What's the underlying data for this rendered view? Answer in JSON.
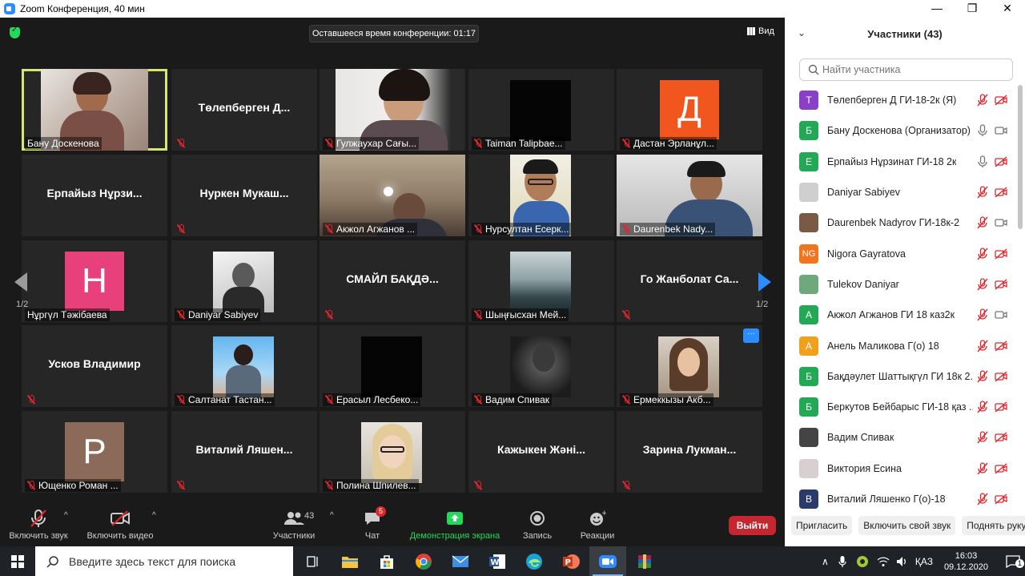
{
  "window": {
    "title": "Zoom Конференция, 40 мин",
    "minimize": "—",
    "restore": "❐",
    "close": "✕"
  },
  "meeting": {
    "timer": "Оставшееся время конференции: 01:17",
    "view_label": "Вид",
    "page_left": "1/2",
    "page_right": "1/2",
    "more": "···",
    "tiles": [
      {
        "label": "Бану Доскенова",
        "name": "",
        "muted": false,
        "kind": "video-1",
        "active": true
      },
      {
        "label": "",
        "name": "Төлепберген Д...",
        "muted": true,
        "kind": "name"
      },
      {
        "label": "Гулжаухар Сағы...",
        "name": "",
        "muted": true,
        "kind": "video-2"
      },
      {
        "label": "Taiman Talipbae...",
        "name": "",
        "muted": true,
        "kind": "black"
      },
      {
        "label": "Дастан Эрланұл...",
        "name": "",
        "muted": true,
        "kind": "avatar",
        "letter": "Д",
        "color": "#f0561d"
      },
      {
        "label": "",
        "name": "Ерпайыз Нұрзи...",
        "muted": false,
        "kind": "name"
      },
      {
        "label": "",
        "name": "Нуркен Мукаш...",
        "muted": true,
        "kind": "name"
      },
      {
        "label": "Акжол Агжанов ...",
        "name": "",
        "muted": true,
        "kind": "video-3"
      },
      {
        "label": "Нурсултан Есерк...",
        "name": "",
        "muted": true,
        "kind": "video-4"
      },
      {
        "label": "Daurenbek Nady...",
        "name": "",
        "muted": true,
        "kind": "video-5"
      },
      {
        "label": "Нұргүл Тәжібаева",
        "name": "",
        "muted": false,
        "kind": "avatar",
        "letter": "Н",
        "color": "#e8407a"
      },
      {
        "label": "Daniyar Sabiyev",
        "name": "",
        "muted": true,
        "kind": "photo-bw"
      },
      {
        "label": "",
        "name": "СМАЙЛ БАҚДӘ...",
        "muted": true,
        "kind": "name"
      },
      {
        "label": "Шыңғысхан Мей...",
        "name": "",
        "muted": true,
        "kind": "photo-forest"
      },
      {
        "label": "",
        "name": "Го Жанболат Са...",
        "muted": true,
        "kind": "name"
      },
      {
        "label": "",
        "name": "Усков Владимир",
        "muted": true,
        "kind": "name"
      },
      {
        "label": "Салтанат Тастан...",
        "name": "",
        "muted": true,
        "kind": "photo-sky"
      },
      {
        "label": "Ерасыл Лесбеко...",
        "name": "",
        "muted": true,
        "kind": "black"
      },
      {
        "label": "Вадим Спивак",
        "name": "",
        "muted": true,
        "kind": "photo-dark"
      },
      {
        "label": "Ермеккызы Акб...",
        "name": "",
        "muted": true,
        "kind": "photo-girl"
      },
      {
        "label": "Ющенко Роман ...",
        "name": "",
        "muted": true,
        "kind": "avatar",
        "letter": "P",
        "color": "#8b6a5a"
      },
      {
        "label": "",
        "name": "Виталий Ляшен...",
        "muted": true,
        "kind": "name"
      },
      {
        "label": "Полина Шпилев...",
        "name": "",
        "muted": true,
        "kind": "photo-blonde"
      },
      {
        "label": "",
        "name": "Кажыкен Жәні...",
        "muted": true,
        "kind": "name"
      },
      {
        "label": "",
        "name": "Зарина Лукман...",
        "muted": true,
        "kind": "name"
      }
    ]
  },
  "toolbar": {
    "audio_label": "Включить звук",
    "video_label": "Включить видео",
    "participants_label": "Участники",
    "participants_count": "43",
    "chat_label": "Чат",
    "chat_badge": "5",
    "share_label": "Демонстрация экрана",
    "record_label": "Запись",
    "reactions_label": "Реакции",
    "leave_label": "Выйти",
    "share_color": "#23d959",
    "leave_color": "#c4272f"
  },
  "panel": {
    "title": "Участники (43)",
    "search_placeholder": "Найти участника",
    "participants": [
      {
        "name": "Төлепберген Д ГИ-18-2к (Я)",
        "initial": "Т",
        "color": "#8a3fc7",
        "mic": "muted",
        "cam": "off"
      },
      {
        "name": "Бану Доскенова (Организатор)",
        "initial": "Б",
        "color": "#23a956",
        "mic": "on",
        "cam": "on"
      },
      {
        "name": "Ерпайыз Нұрзинат ГИ-18 2к",
        "initial": "Е",
        "color": "#23a956",
        "mic": "on",
        "cam": "off"
      },
      {
        "name": "Daniyar Sabiyev",
        "initial": "",
        "color": "#cfcfcf",
        "mic": "muted",
        "cam": "off"
      },
      {
        "name": "Daurenbek Nadyrov ГИ-18к-2",
        "initial": "",
        "color": "#7a5a45",
        "mic": "muted",
        "cam": "on"
      },
      {
        "name": "Nigora Gayratova",
        "initial": "NG",
        "color": "#f0751d",
        "mic": "muted",
        "cam": "off"
      },
      {
        "name": "Tulekov Daniyar",
        "initial": "",
        "color": "#6fa87a",
        "mic": "muted",
        "cam": "off"
      },
      {
        "name": "Акжол Агжанов ГИ 18 каз2к",
        "initial": "А",
        "color": "#23a956",
        "mic": "muted",
        "cam": "on"
      },
      {
        "name": "Анель Маликова Г(о) 18",
        "initial": "А",
        "color": "#f0a01d",
        "mic": "muted",
        "cam": "off"
      },
      {
        "name": "Бақдәулет Шаттықгүл ГИ 18к 2...",
        "initial": "Б",
        "color": "#23a956",
        "mic": "muted",
        "cam": "off"
      },
      {
        "name": "Беркутов Бейбарыс ГИ-18 қаз ...",
        "initial": "Б",
        "color": "#23a956",
        "mic": "muted",
        "cam": "off"
      },
      {
        "name": "Вадим Спивак",
        "initial": "",
        "color": "#444444",
        "mic": "muted",
        "cam": "off"
      },
      {
        "name": "Виктория Есина",
        "initial": "",
        "color": "#d8d0d0",
        "mic": "muted",
        "cam": "off"
      },
      {
        "name": "Виталий Ляшенко Г(о)-18",
        "initial": "В",
        "color": "#2a3a6a",
        "mic": "muted",
        "cam": "off"
      }
    ],
    "invite_label": "Пригласить",
    "unmute_label": "Включить свой звук",
    "raise_hand_label": "Поднять руку"
  },
  "taskbar": {
    "search_placeholder": "Введите здесь текст для поиска",
    "language": "ҚАЗ",
    "time": "16:03",
    "date": "09.12.2020",
    "notifications": "1"
  }
}
